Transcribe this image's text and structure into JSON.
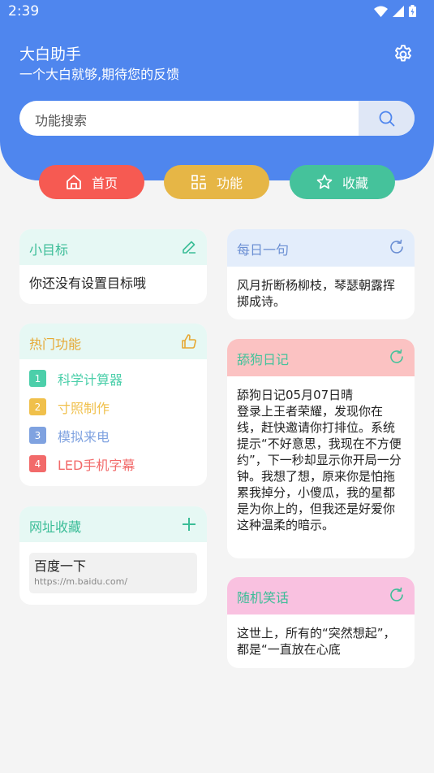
{
  "status": {
    "time": "2:39"
  },
  "app": {
    "title": "大白助手",
    "subtitle": "一个大白就够,期待您的反馈"
  },
  "search": {
    "placeholder": "功能搜索"
  },
  "tabs": [
    {
      "label": "首页",
      "color": "#f65a52",
      "icon": "home-icon"
    },
    {
      "label": "功能",
      "color": "#e6b646",
      "icon": "grid-icon"
    },
    {
      "label": "收藏",
      "color": "#45c29b",
      "icon": "star-icon"
    }
  ],
  "goal": {
    "title": "小目标",
    "text": "你还没有设置目标哦"
  },
  "hot": {
    "title": "热门功能",
    "items": [
      {
        "num": "1",
        "label": "科学计算器",
        "color": "#4ccfaa"
      },
      {
        "num": "2",
        "label": "寸照制作",
        "color": "#f0c04b"
      },
      {
        "num": "3",
        "label": "模拟来电",
        "color": "#7fa2e0"
      },
      {
        "num": "4",
        "label": "LED手机字幕",
        "color": "#f26a6a"
      }
    ]
  },
  "bookmarks": {
    "title": "网址收藏",
    "items": [
      {
        "name": "百度一下",
        "url": "https://m.baidu.com/"
      }
    ]
  },
  "daily": {
    "title": "每日一句",
    "text": "风月折断杨柳枝，琴瑟朝露挥掷成诗。"
  },
  "diary": {
    "title": "舔狗日记",
    "text": "舔狗日记05月07日晴\n登录上王者荣耀，发现你在线，赶快邀请你打排位。系统提示“不好意思，我现在不方便约”，下一秒却显示你开局一分钟。我想了想，原来你是怕拖累我掉分，小傻瓜，我的星都是为你上的，但我还是好爱你这种温柔的暗示。"
  },
  "joke": {
    "title": "随机笑话",
    "text": "这世上，所有的“突然想起”，都是“一直放在心底"
  },
  "colors": {
    "primary": "#4f86ee"
  }
}
